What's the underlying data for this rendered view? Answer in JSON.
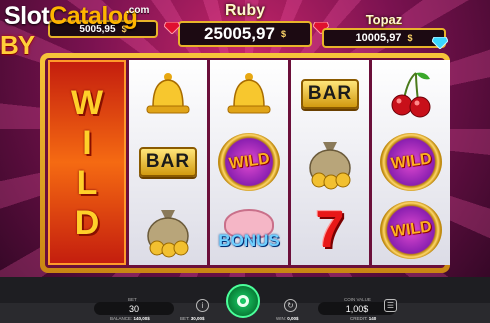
{
  "watermark": {
    "text_a": "Slot",
    "text_b": "Catalog",
    "suffix": ".com"
  },
  "logo_text": "BY",
  "jackpots": [
    {
      "name": "",
      "value": "5005,95",
      "currency": "$"
    },
    {
      "name": "Ruby",
      "value": "25005,97",
      "currency": "$"
    },
    {
      "name": "Topaz",
      "value": "10005,97",
      "currency": "$"
    }
  ],
  "reels": {
    "reel1": {
      "symbol": "WILD",
      "stacked": true
    },
    "reel2": [
      "bell",
      "BAR",
      "money-bag"
    ],
    "reel3": [
      "bell",
      "WILD",
      "BONUS"
    ],
    "reel4": [
      "BAR",
      "money-bag",
      "7"
    ],
    "reel5": [
      "cherries",
      "WILD",
      "WILD"
    ]
  },
  "symbols": {
    "bar": "BAR",
    "wild": "WILD",
    "bonus": "BONUS",
    "seven": "7"
  },
  "controls": {
    "bet_label": "BET",
    "bet_value": "30",
    "coin_label": "COIN VALUE",
    "coin_value": "1,00$",
    "icons": [
      "info-icon",
      "spin-button",
      "autoplay-icon",
      "settings-icon"
    ]
  },
  "status": {
    "balance_label": "BALANCE:",
    "balance_value": "140,00$",
    "bet_label": "BET:",
    "bet_value": "30,00$",
    "win_label": "WIN:",
    "win_value": "0,00$",
    "credit_label": "CREDIT:",
    "credit_value": "140"
  },
  "colors": {
    "accent_gold": "#e8b42a",
    "spin_green": "#0b8a3e",
    "background": "#7a1250"
  }
}
